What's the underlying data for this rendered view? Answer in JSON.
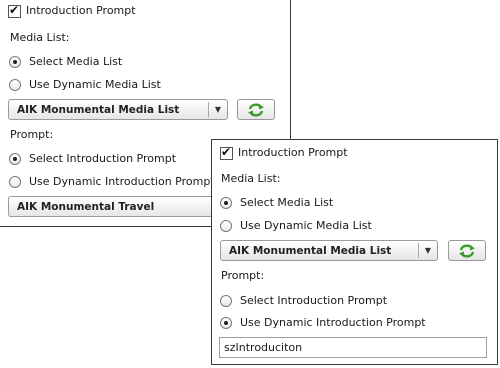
{
  "panel_a": {
    "intro_prompt_label": "Introduction Prompt",
    "intro_prompt_checked": true,
    "media_list_heading": "Media List:",
    "select_media_list_label": "Select Media List",
    "use_dynamic_media_list_label": "Use Dynamic Media List",
    "media_list_selected": "select",
    "media_list_value": "AIK Monumental Media List",
    "prompt_heading": "Prompt:",
    "select_intro_prompt_label": "Select Introduction Prompt",
    "use_dynamic_intro_prompt_label": "Use Dynamic Introduction Prompt",
    "prompt_selected": "select",
    "prompt_value": "AIK Monumental Travel"
  },
  "panel_b": {
    "intro_prompt_label": "Introduction Prompt",
    "intro_prompt_checked": true,
    "media_list_heading": "Media List:",
    "select_media_list_label": "Select Media List",
    "use_dynamic_media_list_label": "Use Dynamic Media List",
    "media_list_selected": "select",
    "media_list_value": "AIK Monumental Media List",
    "prompt_heading": "Prompt:",
    "select_intro_prompt_label": "Select Introduction Prompt",
    "use_dynamic_intro_prompt_label": "Use Dynamic Introduction Prompt",
    "prompt_selected": "dynamic",
    "prompt_text_value": "szIntroduciton"
  },
  "icons": {
    "refresh": "refresh-icon",
    "dropdown": "chevron-down-icon",
    "check": "checkmark-icon"
  },
  "colors": {
    "refresh_green": "#3a9a2a",
    "border": "#3a3a3a"
  }
}
